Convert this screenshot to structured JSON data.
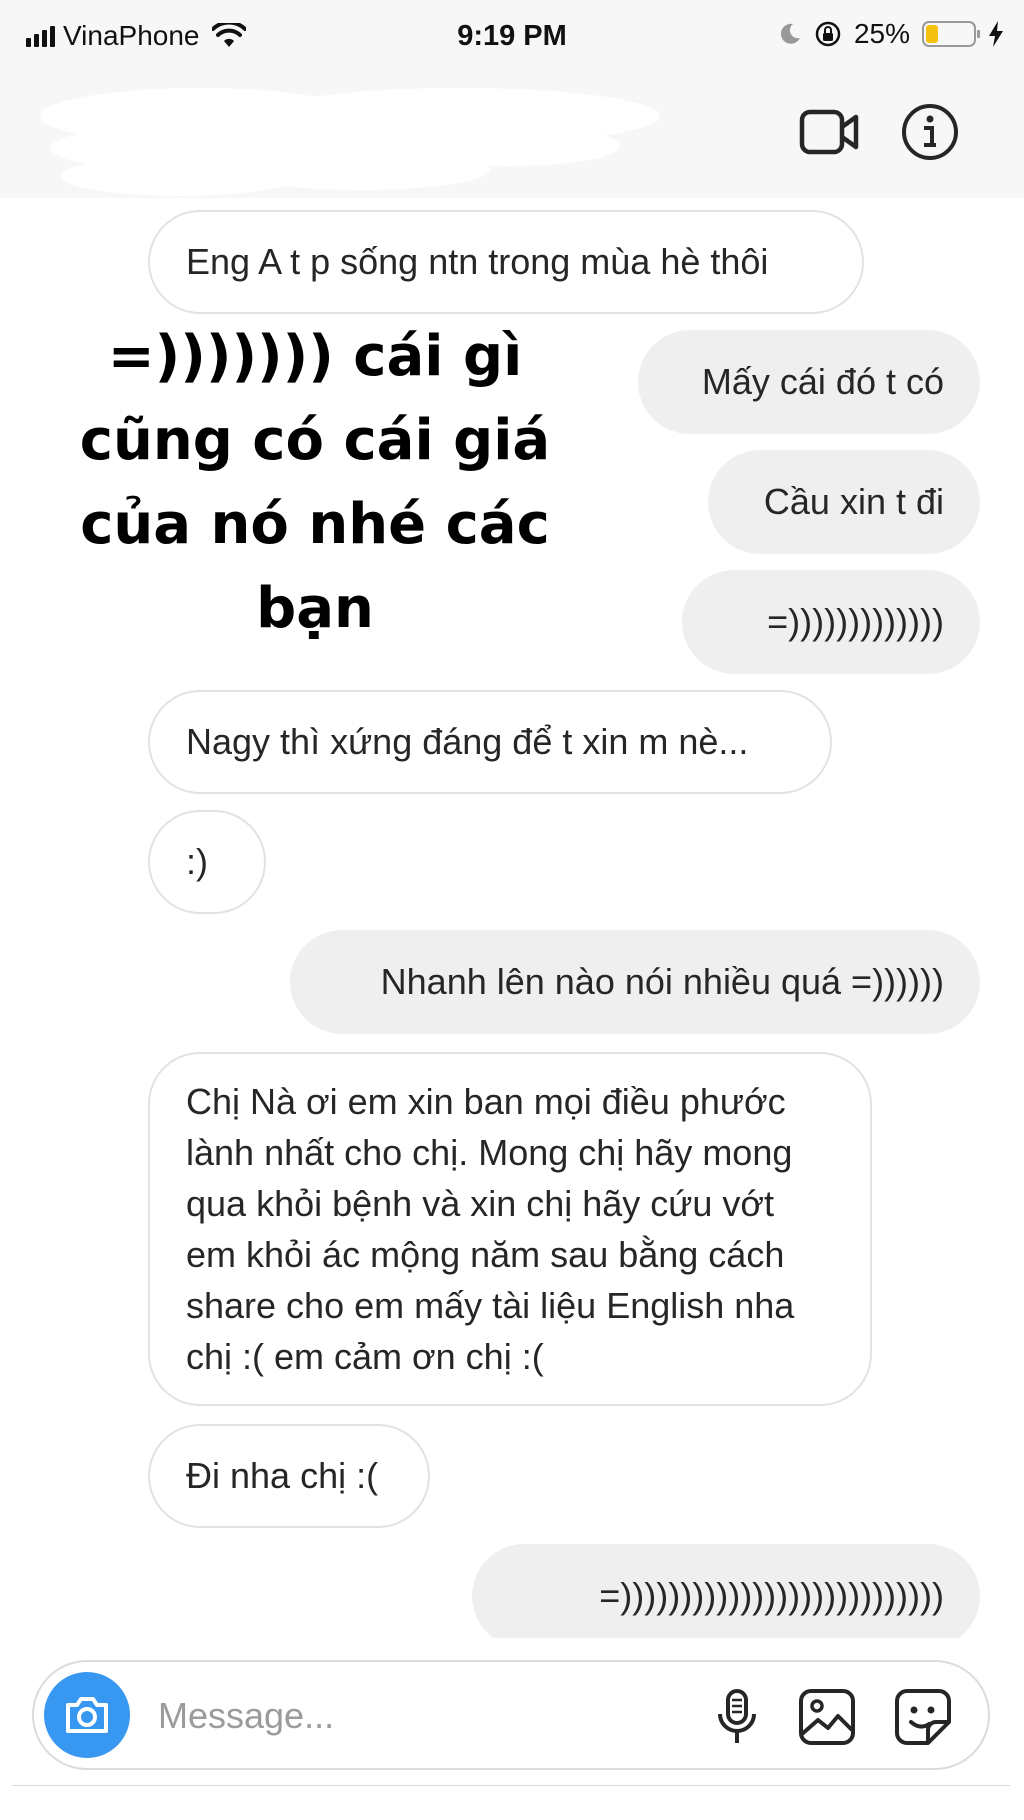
{
  "status_bar": {
    "carrier": "VinaPhone",
    "time": "9:19 PM",
    "battery_percent_text": "25%",
    "battery_level": 0.25,
    "icons": [
      "signal-icon",
      "wifi-icon",
      "moon-icon",
      "rotation-lock-icon",
      "battery-icon",
      "charging-bolt-icon"
    ]
  },
  "header": {
    "icons": [
      "video-call-icon",
      "info-icon"
    ]
  },
  "overlay_caption": "=))))))) cái gì cũng có cái giá của nó nhé các bạn",
  "messages": [
    {
      "direction": "in",
      "text": "Eng A t p sống ntn trong mùa hè thôi"
    },
    {
      "direction": "out",
      "text": "Mấy cái đó t có"
    },
    {
      "direction": "out",
      "text": "Cầu xin t đi"
    },
    {
      "direction": "out",
      "text": "=)))))))))))))"
    },
    {
      "direction": "in",
      "text": "Nagy thì xứng đáng để t xin m nè..."
    },
    {
      "direction": "in",
      "text": ":)"
    },
    {
      "direction": "out",
      "text": "Nhanh lên nào nói nhiều quá =))))))"
    },
    {
      "direction": "in",
      "text": "Chị Nà ơi em xin ban mọi điều phước lành nhất cho chị. Mong chị hãy mong qua khỏi bệnh và xin chị hãy cứu vớt em khỏi ác mộng năm sau bằng cách share cho em mấy tài liệu English nha chị :( em cảm ơn chị :("
    },
    {
      "direction": "in",
      "text": "Đi nha chị :("
    },
    {
      "direction": "out",
      "text": "=)))))))))))))))))))))))))))"
    }
  ],
  "composer": {
    "placeholder": "Message...",
    "value": "",
    "icons": [
      "camera-icon",
      "microphone-icon",
      "gallery-icon",
      "sticker-icon"
    ]
  },
  "colors": {
    "accent": "#3897f0",
    "outgoing_bubble": "#efefef",
    "incoming_border": "#e2e2e2",
    "battery": "#f4c10f"
  }
}
